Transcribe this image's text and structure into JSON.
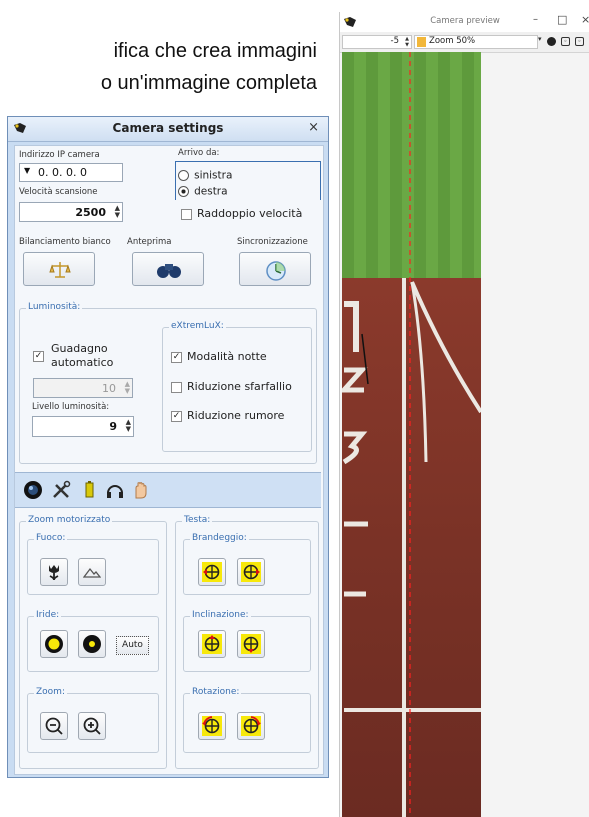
{
  "document": {
    "line1": "ifica che crea immagini",
    "line2": "o un'immagine completa"
  },
  "camera_settings": {
    "title": "Camera settings",
    "close_glyph": "×",
    "ip_label": "Indirizzo IP camera",
    "ip_value": "0. 0. 0. 0",
    "scan_speed_label": "Velocità scansione",
    "scan_speed_value": "2500",
    "arrival_label": "Arrivo da:",
    "arrival_options": [
      "sinistra",
      "destra"
    ],
    "arrival_selected": "destra",
    "double_speed_label": "Raddoppio velocità",
    "white_balance_label": "Bilanciamento bianco",
    "preview_label": "Anteprima",
    "sync_label": "Sincronizzazione",
    "brightness": {
      "group_label": "Luminosità:",
      "auto_gain_line1": "Guadagno",
      "auto_gain_line2": "automatico",
      "auto_gain_checked": true,
      "gain_value": "10",
      "level_label": "Livello luminosità:",
      "level_value": "9"
    },
    "extremlux": {
      "group_label": "eXtremLuX:",
      "night_mode_label": "Modalità notte",
      "night_mode_checked": true,
      "flicker_label": "Riduzione sfarfallio",
      "flicker_checked": false,
      "noise_label": "Riduzione rumore",
      "noise_checked": true
    },
    "tabs": [
      "lens-icon",
      "tools-icon",
      "battery-icon",
      "headset-icon",
      "hand-icon"
    ],
    "zoom_motor": {
      "group_label": "Zoom motorizzato",
      "focus_label": "Fuoco:",
      "iris_label": "Iride:",
      "auto_label": "Auto",
      "zoom_label": "Zoom:"
    },
    "head": {
      "group_label": "Testa:",
      "pan_label": "Brandeggio:",
      "tilt_label": "Inclinazione:",
      "rotation_label": "Rotazione:"
    }
  },
  "camera_preview": {
    "title": "Camera preview",
    "offset_value": "-5",
    "zoom_label": "Zoom 50%",
    "minimize_glyph": "–",
    "maximize_glyph": "□",
    "close_glyph": "×"
  },
  "colors": {
    "window_frame": "#c9dcf2",
    "accent_blue": "#3a6fb0",
    "button_yellow": "#f7e80a",
    "grass_green": "#5e9a3c",
    "track_red": "#7a3226"
  }
}
